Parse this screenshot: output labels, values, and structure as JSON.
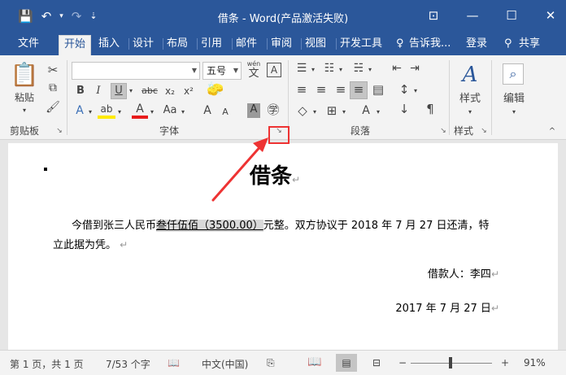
{
  "titlebar": {
    "title": "借条 - Word(产品激活失败)",
    "qat": {
      "save_icon": "💾",
      "undo_icon": "↶",
      "undo_dd": "▾",
      "redo_icon": "↷",
      "customize_icon": "⇣"
    },
    "buttons": {
      "ribbon_display": "⊡",
      "minimize": "—",
      "maximize": "☐",
      "close": "✕"
    }
  },
  "tabs": {
    "file": "文件",
    "home": "开始",
    "insert": "插入",
    "design": "设计",
    "layout": "布局",
    "references": "引用",
    "mailings": "邮件",
    "review": "审阅",
    "view": "视图",
    "developer": "开发工具",
    "tellme": "告诉我...",
    "signin": "登录",
    "share": "共享"
  },
  "ribbon": {
    "clipboard": {
      "label": "剪贴板",
      "paste": "粘贴",
      "cut": "✂",
      "copy": "⧉",
      "format_painter": "🖌"
    },
    "font": {
      "label": "字体",
      "font_name": "",
      "font_size": "五号",
      "wen": "wén",
      "wen_char": "文",
      "char_border": "A",
      "bold": "B",
      "italic": "I",
      "underline": "U",
      "strike": "abc",
      "sub": "x₂",
      "sup": "x²",
      "text_effects": "A",
      "highlight": "ab",
      "font_color": "A",
      "change_case": "Aa",
      "grow": "A",
      "shrink": "A",
      "char_shading": "A",
      "enclose": "㊫",
      "clear": "🧽"
    },
    "paragraph": {
      "label": "段落",
      "bullets": "☰",
      "numbering": "☷",
      "multilevel": "☵",
      "decrease_indent": "⇤",
      "increase_indent": "⇥",
      "align_left": "≡",
      "center": "≡",
      "align_right": "≡",
      "justify": "≡",
      "distributed": "▤",
      "line_spacing": "↕",
      "shading": "◇",
      "borders": "⊞",
      "chinese_layout": "A",
      "sort": "↓",
      "show_marks": "¶"
    },
    "styles": {
      "label": "样式",
      "button": "样式"
    },
    "editing": {
      "label": "编辑",
      "button": "编辑"
    }
  },
  "document": {
    "title": "借条",
    "body_pre": "今借到张三人民币",
    "amount": "叁仟伍佰（3500.00）",
    "body_post": "元整。双方协议于 2018 年 7 月 27 日还清，特",
    "body_line2": "立此据为凭。",
    "borrower": "借款人：李四",
    "date": "2017 年 7 月 27 日",
    "para_mark": "↵"
  },
  "statusbar": {
    "page": "第 1 页，共 1 页",
    "words": "7/53 个字",
    "proof_icon": "📖",
    "language": "中文(中国)",
    "macro_icon": "⎘",
    "zoom_minus": "−",
    "zoom_plus": "+",
    "zoom": "91%"
  }
}
